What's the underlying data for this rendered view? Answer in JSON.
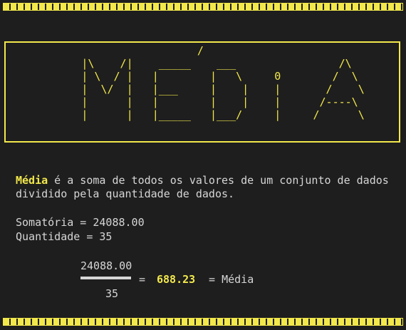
{
  "colors": {
    "background": "#1e1e1e",
    "accent": "#f2e84b",
    "text": "#d6d6d6"
  },
  "banner": {
    "ascii_lines": [
      "                              /                              ",
      "            |\\    /|    _____    ___                /\\      ",
      "            | \\  / |   |        |   \\     0        /  \\     ",
      "            |  \\/  |   |___     |    |    |       /    \\    ",
      "            |      |   |        |    |    |      /----\\    ",
      "            |      |   |_____   |___/     |     /      \\   "
    ]
  },
  "definition": {
    "term": "Média",
    "line1_rest": " é a soma de todos os valores de um conjunto de dados",
    "line2": "dividido pela quantidade de dados."
  },
  "stats": {
    "sum_line": "Somatória = 24088.00",
    "count_line": "Quantidade = 35"
  },
  "fraction": {
    "numerator": "24088.00",
    "denominator": "35",
    "equals": "=",
    "result": "688.23",
    "result_label": " = Média"
  }
}
